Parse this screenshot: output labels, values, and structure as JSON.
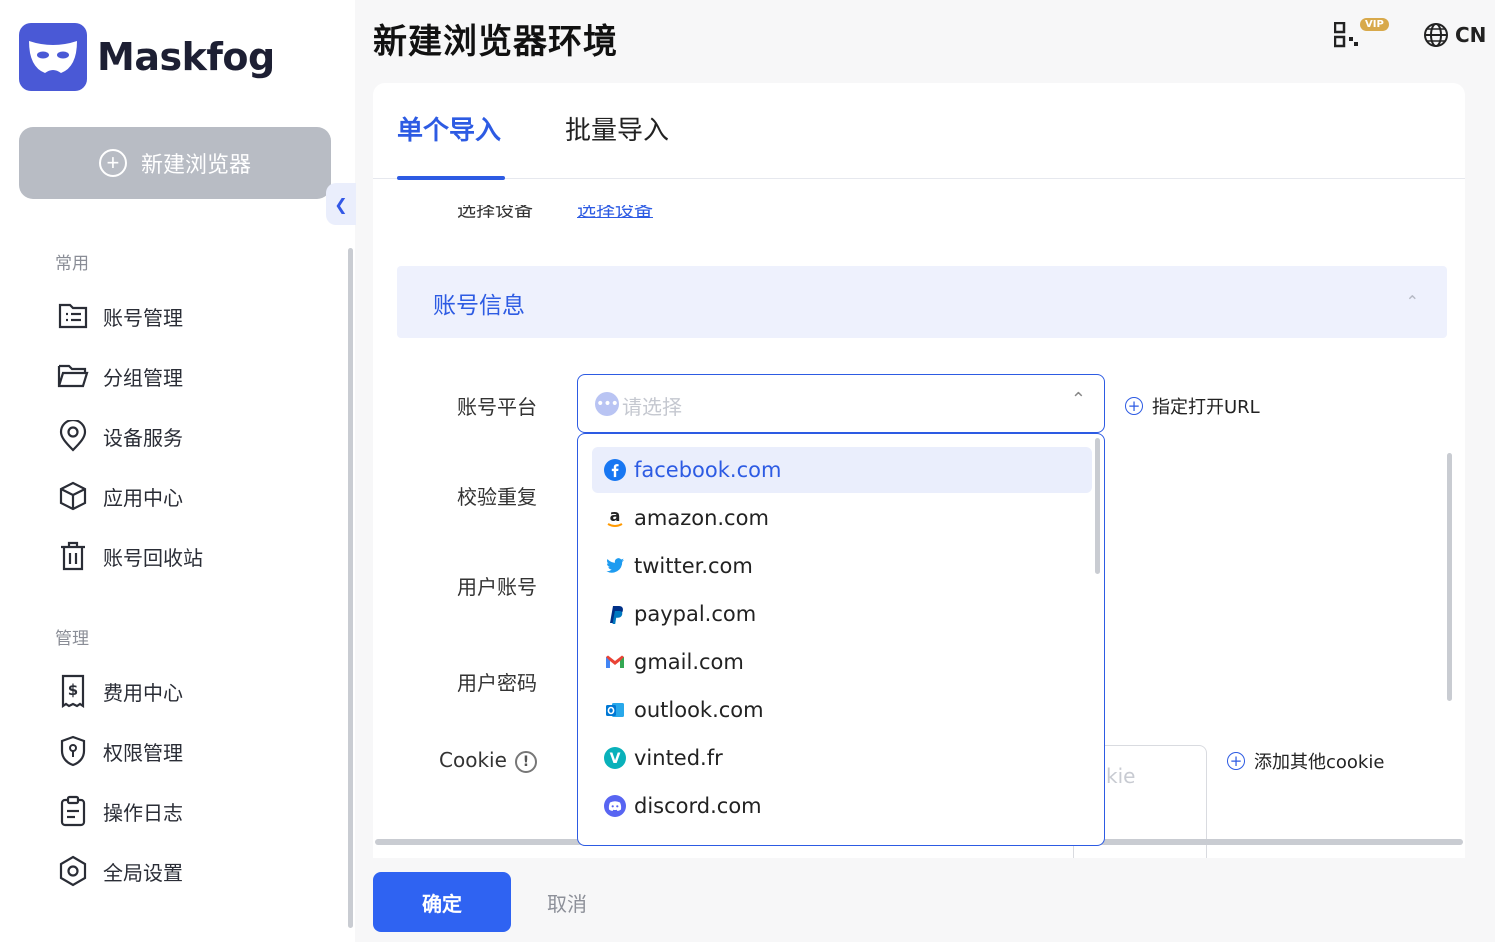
{
  "app": {
    "name": "Maskfog"
  },
  "sidebar": {
    "new_button": "新建浏览器",
    "section_common": "常用",
    "section_manage": "管理",
    "items_common": [
      {
        "label": "账号管理",
        "icon": "account-list-icon"
      },
      {
        "label": "分组管理",
        "icon": "folder-icon"
      },
      {
        "label": "设备服务",
        "icon": "location-pin-icon"
      },
      {
        "label": "应用中心",
        "icon": "cube-icon"
      },
      {
        "label": "账号回收站",
        "icon": "trash-icon"
      }
    ],
    "items_manage": [
      {
        "label": "费用中心",
        "icon": "bill-icon"
      },
      {
        "label": "权限管理",
        "icon": "shield-icon"
      },
      {
        "label": "操作日志",
        "icon": "clipboard-icon"
      },
      {
        "label": "全局设置",
        "icon": "settings-hexagon-icon"
      }
    ]
  },
  "header": {
    "title": "新建浏览器环境",
    "vip_badge": "VIP",
    "language": "CN"
  },
  "tabs": {
    "single": "单个导入",
    "batch": "批量导入"
  },
  "form": {
    "cut_label": "选择设备",
    "cut_link": "选择设备",
    "section_title": "账号信息",
    "platform_label": "账号平台",
    "platform_placeholder": "请选择",
    "url_link": "指定打开URL",
    "dedupe_label": "校验重复",
    "username_label": "用户账号",
    "password_label": "用户密码",
    "cookie_label": "Cookie",
    "cookie_placeholder": "kie",
    "add_cookie": "添加其他cookie"
  },
  "dropdown": {
    "options": [
      {
        "label": "facebook.com",
        "icon": "facebook-icon",
        "selected": true
      },
      {
        "label": "amazon.com",
        "icon": "amazon-icon"
      },
      {
        "label": "twitter.com",
        "icon": "twitter-icon"
      },
      {
        "label": "paypal.com",
        "icon": "paypal-icon"
      },
      {
        "label": "gmail.com",
        "icon": "gmail-icon"
      },
      {
        "label": "outlook.com",
        "icon": "outlook-icon"
      },
      {
        "label": "vinted.fr",
        "icon": "vinted-icon"
      },
      {
        "label": "discord.com",
        "icon": "discord-icon"
      }
    ]
  },
  "footer": {
    "confirm": "确定",
    "cancel": "取消"
  },
  "colors": {
    "accent": "#2d5be3",
    "logo": "#4a59d6",
    "confirm_button": "#2f63f2",
    "vip": "#d8a94b"
  }
}
